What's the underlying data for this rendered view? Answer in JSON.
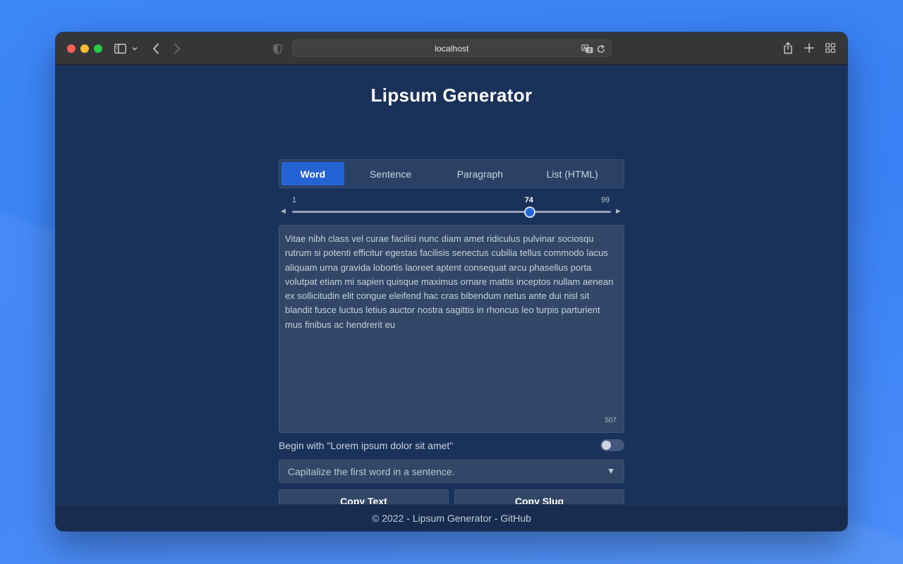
{
  "browser": {
    "url": "localhost"
  },
  "page": {
    "title": "Lipsum Generator"
  },
  "tabs": [
    {
      "label": "Word",
      "active": true
    },
    {
      "label": "Sentence",
      "active": false
    },
    {
      "label": "Paragraph",
      "active": false
    },
    {
      "label": "List (HTML)",
      "active": false
    }
  ],
  "slider": {
    "min": "1",
    "max": "99",
    "value": "74",
    "value_number": 74,
    "min_number": 1,
    "max_number": 99
  },
  "output": {
    "text": "Vitae nibh class vel curae facilisi nunc diam amet ridiculus pulvinar sociosqu rutrum si potenti efficitur egestas facilisis senectus cubilia tellus commodo lacus aliquam urna gravida lobortis laoreet aptent consequat arcu phasellus porta volutpat etiam mi sapien quisque maximus ornare mattis inceptos nullam aenean ex sollicitudin elit congue eleifend hac cras bibendum netus ante dui nisl sit blandit fusce luctus letius auctor nostra sagittis in rhoncus leo turpis parturient mus finibus ac hendrerit eu",
    "char_count": "507"
  },
  "options": {
    "lorem_toggle_label": "Begin with \"Lorem ipsum dolor sit amet\"",
    "lorem_toggle_on": false,
    "capitalize_select_value": "Capitalize the first word in a sentence."
  },
  "buttons": {
    "copy_text": "Copy Text",
    "copy_slug": "Copy Slug"
  },
  "footer": {
    "text": "© 2022 - Lipsum Generator - GitHub"
  },
  "colors": {
    "page_bg": "#1a3259",
    "accent": "#2463d4",
    "desktop_bg": "#3a82f6"
  }
}
